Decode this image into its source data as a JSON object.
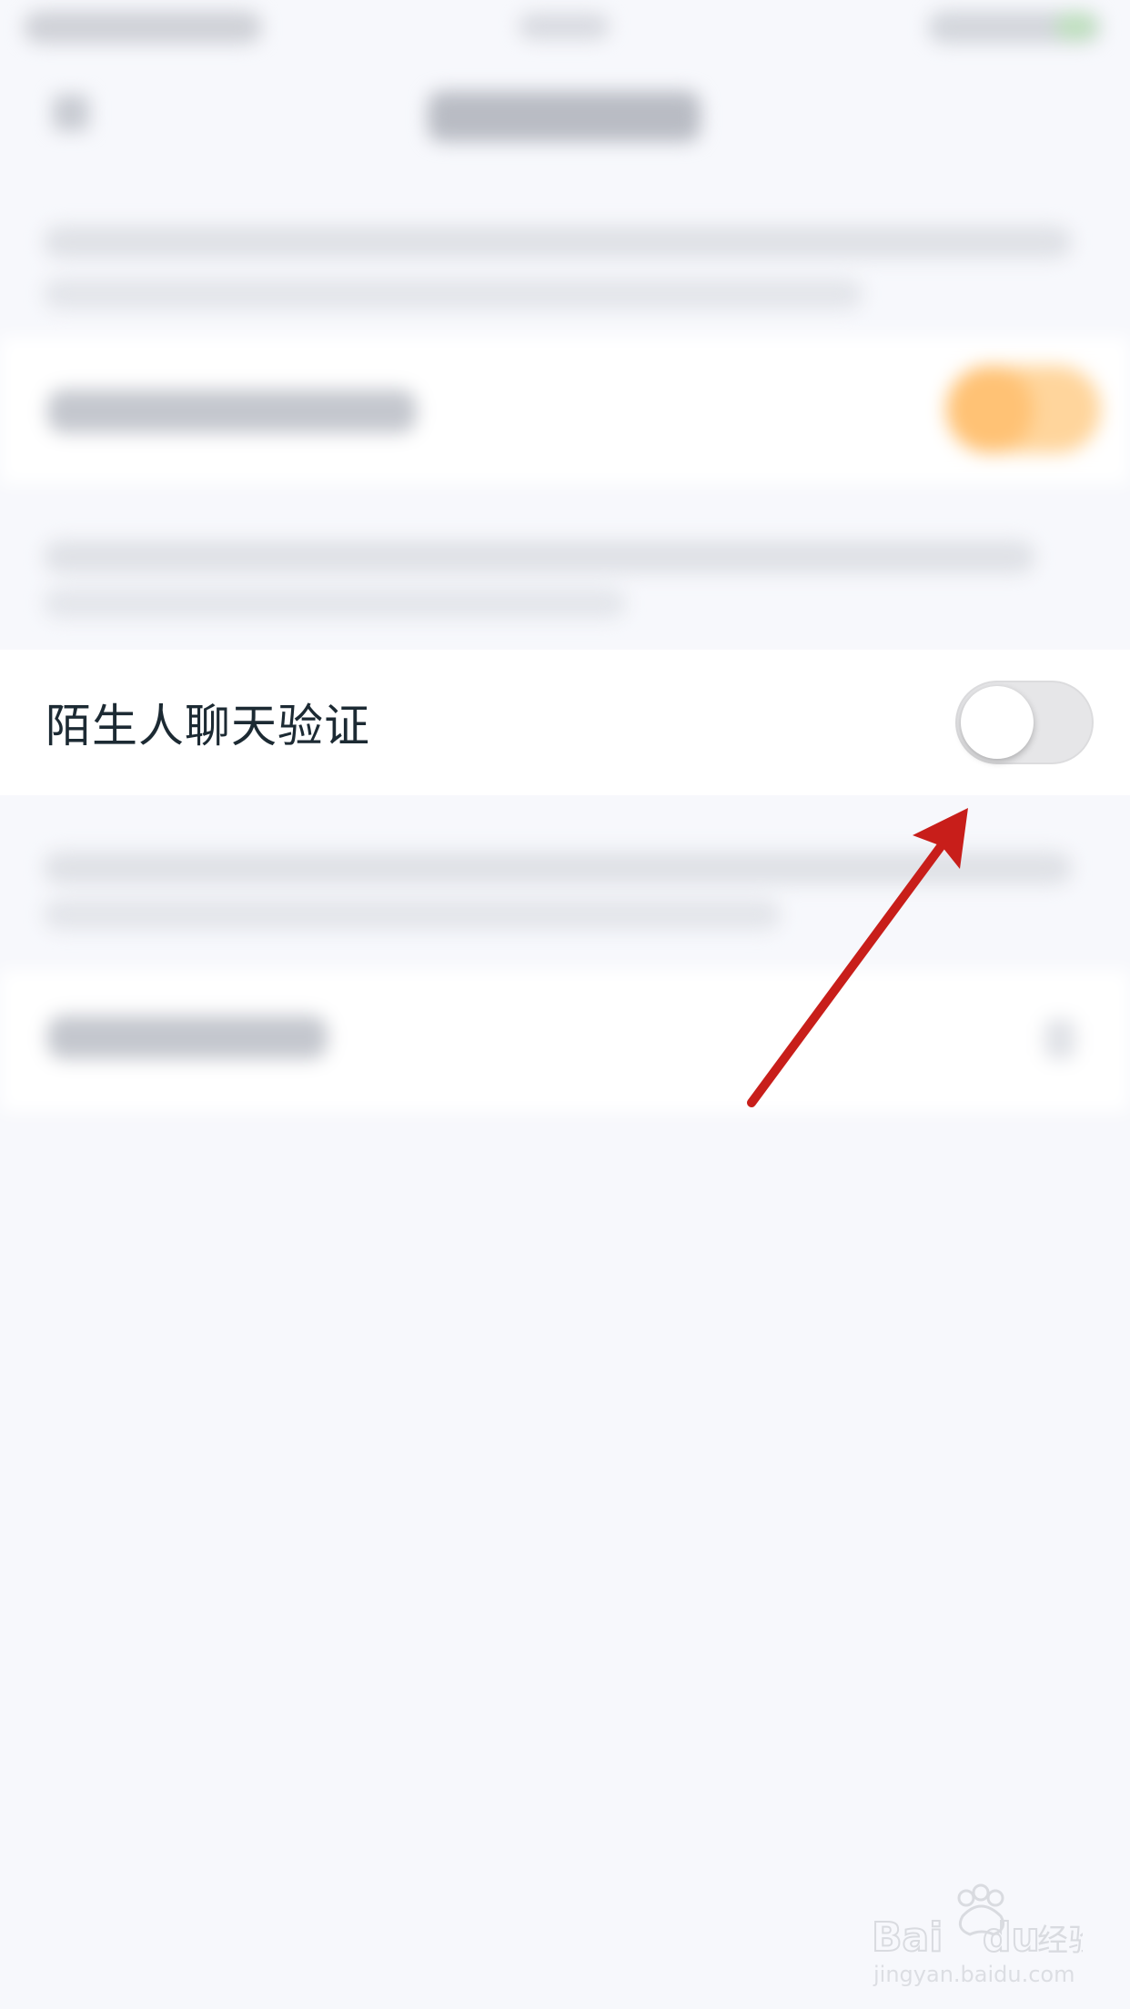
{
  "settings": {
    "stranger_chat_verification": {
      "label": "陌生人聊天验证",
      "toggle_state": "off"
    }
  },
  "colors": {
    "background": "#f7f8fc",
    "card": "#ffffff",
    "label_text": "#1c2a33",
    "toggle_off_track": "#e6e6e8",
    "annotation_arrow": "#c81e1a"
  },
  "watermark": {
    "brand": "Baidu经验",
    "url": "jingyan.baidu.com"
  }
}
